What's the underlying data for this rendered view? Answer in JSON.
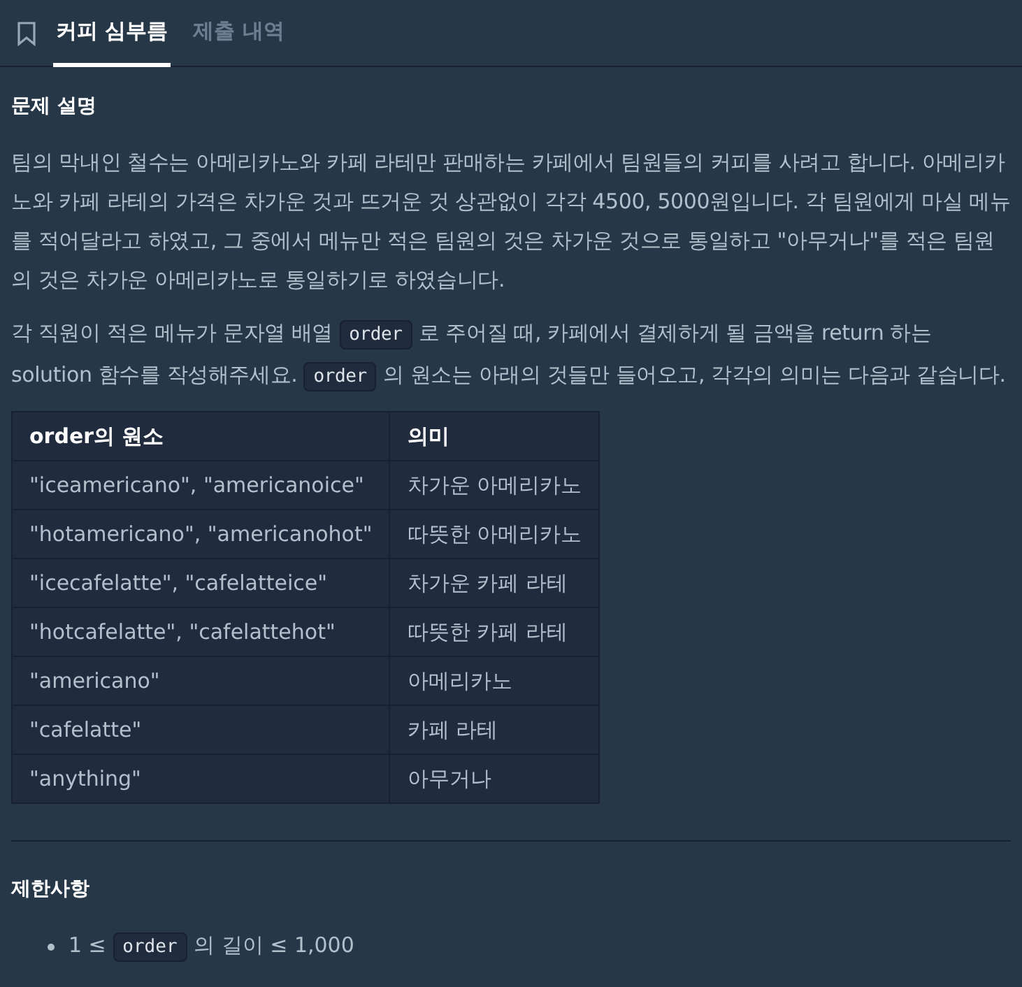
{
  "tabs": [
    {
      "label": "커피 심부름",
      "selected": true
    },
    {
      "label": "제출 내역",
      "selected": false
    }
  ],
  "description": {
    "heading": "문제 설명",
    "paragraphs": [
      [
        {
          "kind": "text",
          "text": "팀의 막내인 철수는 아메리카노와 카페 라테만 판매하는 카페에서 팀원들의 커피를 사려고 합니다. 아메리카노와 카페 라테의 가격은 차가운 것과 뜨거운 것 상관없이 각각 4500, 5000원입니다. 각 팀원에게 마실 메뉴를 적어달라고 하였고, 그 중에서 메뉴만 적은 팀원의 것은 차가운 것으로 통일하고 \"아무거나\"를 적은 팀원의 것은 차가운 아메리카노로 통일하기로 하였습니다."
        }
      ],
      [
        {
          "kind": "text",
          "text": "각 직원이 적은 메뉴가 문자열 배열 "
        },
        {
          "kind": "code",
          "text": "order"
        },
        {
          "kind": "text",
          "text": " 로 주어질 때, 카페에서 결제하게 될 금액을 return 하는 solution 함수를 작성해주세요. "
        },
        {
          "kind": "code",
          "text": "order"
        },
        {
          "kind": "text",
          "text": " 의 원소는 아래의 것들만 들어오고, 각각의 의미는 다음과 같습니다."
        }
      ]
    ],
    "table": {
      "columns": [
        "order의 원소",
        "의미"
      ],
      "rows": [
        [
          "\"iceamericano\", \"americanoice\"",
          "차가운 아메리카노"
        ],
        [
          "\"hotamericano\", \"americanohot\"",
          "따뜻한 아메리카노"
        ],
        [
          "\"icecafelatte\", \"cafelatteice\"",
          "차가운 카페 라테"
        ],
        [
          "\"hotcafelatte\", \"cafelattehot\"",
          "따뜻한 카페 라테"
        ],
        [
          "\"americano\"",
          "아메리카노"
        ],
        [
          "\"cafelatte\"",
          "카페 라테"
        ],
        [
          "\"anything\"",
          "아무거나"
        ]
      ]
    }
  },
  "constraints": {
    "heading": "제한사항",
    "items": [
      [
        {
          "kind": "text",
          "text": "1 ≤ "
        },
        {
          "kind": "code",
          "text": "order"
        },
        {
          "kind": "text",
          "text": " 의 길이 ≤ 1,000"
        }
      ]
    ]
  }
}
